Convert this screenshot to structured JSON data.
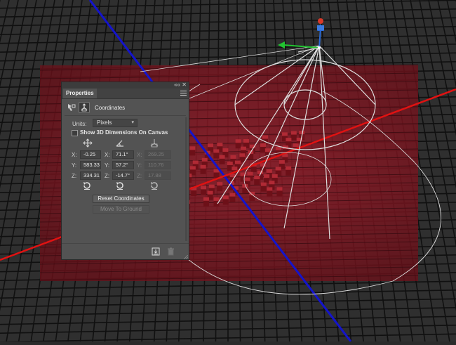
{
  "panel": {
    "tab_label": "Properties",
    "collapse_glyph": "««",
    "close_glyph": "✕",
    "mode_title": "Coordinates",
    "mode_icons": [
      "scene-filter-icon",
      "coordinates-icon"
    ],
    "units_label": "Units:",
    "units_value": "Pixels",
    "show3d_label": "Show 3D Dimensions On Canvas",
    "show3d_checked": false,
    "columns": [
      {
        "name": "position",
        "icon": "move-cross-icon",
        "reset_icon": "reset-position-icon",
        "rows": [
          {
            "label": "X:",
            "value": "-0.25"
          },
          {
            "label": "Y:",
            "value": "583.33"
          },
          {
            "label": "Z:",
            "value": "334.31"
          }
        ]
      },
      {
        "name": "rotation",
        "icon": "rotation-angle-icon",
        "reset_icon": "reset-rotation-icon",
        "rows": [
          {
            "label": "X:",
            "value": "71.1°"
          },
          {
            "label": "Y:",
            "value": "57.2°"
          },
          {
            "label": "Z:",
            "value": "-14.7°"
          }
        ]
      },
      {
        "name": "scale",
        "icon": "scale-icon",
        "reset_icon": "reset-scale-icon",
        "disabled": true,
        "rows": [
          {
            "label": "X:",
            "value": "269.25"
          },
          {
            "label": "Y:",
            "value": "110.76"
          },
          {
            "label": "Z:",
            "value": "17.88"
          }
        ]
      }
    ],
    "reset_coordinates_label": "Reset Coordinates",
    "move_to_ground_label": "Move To Ground",
    "footer_icons": [
      "render-icon",
      "trash-icon"
    ]
  },
  "colors": {
    "canvas_bg": "#2b2b2b",
    "grid_line": "#121212",
    "red_plane": "#8c1b26",
    "z_axis": "#1a1ad0",
    "x_axis": "#e01010",
    "gizmo_green": "#22c431",
    "gizmo_blue": "#2a6bd8",
    "gizmo_red": "#d83a2a",
    "light_guides": "#dedede"
  }
}
